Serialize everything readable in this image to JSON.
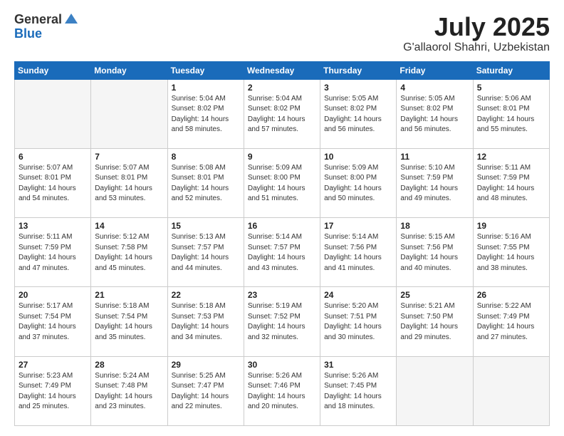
{
  "header": {
    "logo_general": "General",
    "logo_blue": "Blue",
    "month_title": "July 2025",
    "location": "G'allaorol Shahri, Uzbekistan"
  },
  "days_of_week": [
    "Sunday",
    "Monday",
    "Tuesday",
    "Wednesday",
    "Thursday",
    "Friday",
    "Saturday"
  ],
  "weeks": [
    [
      {
        "day": "",
        "info": ""
      },
      {
        "day": "",
        "info": ""
      },
      {
        "day": "1",
        "info": "Sunrise: 5:04 AM\nSunset: 8:02 PM\nDaylight: 14 hours\nand 58 minutes."
      },
      {
        "day": "2",
        "info": "Sunrise: 5:04 AM\nSunset: 8:02 PM\nDaylight: 14 hours\nand 57 minutes."
      },
      {
        "day": "3",
        "info": "Sunrise: 5:05 AM\nSunset: 8:02 PM\nDaylight: 14 hours\nand 56 minutes."
      },
      {
        "day": "4",
        "info": "Sunrise: 5:05 AM\nSunset: 8:02 PM\nDaylight: 14 hours\nand 56 minutes."
      },
      {
        "day": "5",
        "info": "Sunrise: 5:06 AM\nSunset: 8:01 PM\nDaylight: 14 hours\nand 55 minutes."
      }
    ],
    [
      {
        "day": "6",
        "info": "Sunrise: 5:07 AM\nSunset: 8:01 PM\nDaylight: 14 hours\nand 54 minutes."
      },
      {
        "day": "7",
        "info": "Sunrise: 5:07 AM\nSunset: 8:01 PM\nDaylight: 14 hours\nand 53 minutes."
      },
      {
        "day": "8",
        "info": "Sunrise: 5:08 AM\nSunset: 8:01 PM\nDaylight: 14 hours\nand 52 minutes."
      },
      {
        "day": "9",
        "info": "Sunrise: 5:09 AM\nSunset: 8:00 PM\nDaylight: 14 hours\nand 51 minutes."
      },
      {
        "day": "10",
        "info": "Sunrise: 5:09 AM\nSunset: 8:00 PM\nDaylight: 14 hours\nand 50 minutes."
      },
      {
        "day": "11",
        "info": "Sunrise: 5:10 AM\nSunset: 7:59 PM\nDaylight: 14 hours\nand 49 minutes."
      },
      {
        "day": "12",
        "info": "Sunrise: 5:11 AM\nSunset: 7:59 PM\nDaylight: 14 hours\nand 48 minutes."
      }
    ],
    [
      {
        "day": "13",
        "info": "Sunrise: 5:11 AM\nSunset: 7:59 PM\nDaylight: 14 hours\nand 47 minutes."
      },
      {
        "day": "14",
        "info": "Sunrise: 5:12 AM\nSunset: 7:58 PM\nDaylight: 14 hours\nand 45 minutes."
      },
      {
        "day": "15",
        "info": "Sunrise: 5:13 AM\nSunset: 7:57 PM\nDaylight: 14 hours\nand 44 minutes."
      },
      {
        "day": "16",
        "info": "Sunrise: 5:14 AM\nSunset: 7:57 PM\nDaylight: 14 hours\nand 43 minutes."
      },
      {
        "day": "17",
        "info": "Sunrise: 5:14 AM\nSunset: 7:56 PM\nDaylight: 14 hours\nand 41 minutes."
      },
      {
        "day": "18",
        "info": "Sunrise: 5:15 AM\nSunset: 7:56 PM\nDaylight: 14 hours\nand 40 minutes."
      },
      {
        "day": "19",
        "info": "Sunrise: 5:16 AM\nSunset: 7:55 PM\nDaylight: 14 hours\nand 38 minutes."
      }
    ],
    [
      {
        "day": "20",
        "info": "Sunrise: 5:17 AM\nSunset: 7:54 PM\nDaylight: 14 hours\nand 37 minutes."
      },
      {
        "day": "21",
        "info": "Sunrise: 5:18 AM\nSunset: 7:54 PM\nDaylight: 14 hours\nand 35 minutes."
      },
      {
        "day": "22",
        "info": "Sunrise: 5:18 AM\nSunset: 7:53 PM\nDaylight: 14 hours\nand 34 minutes."
      },
      {
        "day": "23",
        "info": "Sunrise: 5:19 AM\nSunset: 7:52 PM\nDaylight: 14 hours\nand 32 minutes."
      },
      {
        "day": "24",
        "info": "Sunrise: 5:20 AM\nSunset: 7:51 PM\nDaylight: 14 hours\nand 30 minutes."
      },
      {
        "day": "25",
        "info": "Sunrise: 5:21 AM\nSunset: 7:50 PM\nDaylight: 14 hours\nand 29 minutes."
      },
      {
        "day": "26",
        "info": "Sunrise: 5:22 AM\nSunset: 7:49 PM\nDaylight: 14 hours\nand 27 minutes."
      }
    ],
    [
      {
        "day": "27",
        "info": "Sunrise: 5:23 AM\nSunset: 7:49 PM\nDaylight: 14 hours\nand 25 minutes."
      },
      {
        "day": "28",
        "info": "Sunrise: 5:24 AM\nSunset: 7:48 PM\nDaylight: 14 hours\nand 23 minutes."
      },
      {
        "day": "29",
        "info": "Sunrise: 5:25 AM\nSunset: 7:47 PM\nDaylight: 14 hours\nand 22 minutes."
      },
      {
        "day": "30",
        "info": "Sunrise: 5:26 AM\nSunset: 7:46 PM\nDaylight: 14 hours\nand 20 minutes."
      },
      {
        "day": "31",
        "info": "Sunrise: 5:26 AM\nSunset: 7:45 PM\nDaylight: 14 hours\nand 18 minutes."
      },
      {
        "day": "",
        "info": ""
      },
      {
        "day": "",
        "info": ""
      }
    ]
  ]
}
